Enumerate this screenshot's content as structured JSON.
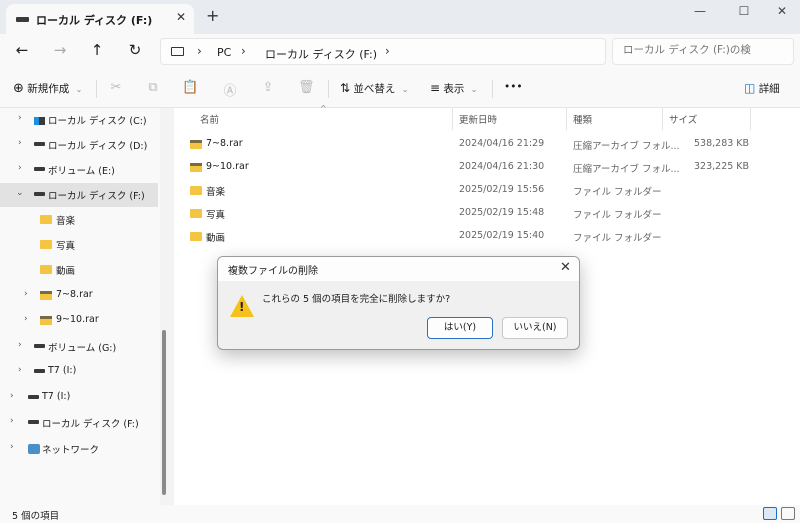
{
  "tab": {
    "title": "ローカル ディスク (F:)",
    "close": "✕",
    "new": "+"
  },
  "window": {
    "minimize": "—",
    "maximize": "☐",
    "close": "✕"
  },
  "nav": {
    "back": "←",
    "forward": "→",
    "up": "↑",
    "refresh": "↻"
  },
  "address": {
    "crumbs": [
      "PC",
      "ローカル ディスク (F:)"
    ],
    "sep": "›"
  },
  "search": {
    "placeholder": "ローカル ディスク (F:)の検"
  },
  "toolbar": {
    "new_label": "新規作成",
    "new_icon": "⊕",
    "sort_label": "並べ替え",
    "sort_icon": "⇅",
    "view_label": "表示",
    "view_icon": "≡",
    "more": "•••",
    "details_label": "詳細",
    "details_icon": "◫",
    "cut_icon": "✂",
    "copy_icon": "⧉",
    "paste_icon": "📋",
    "rename_icon": "Ⓐ",
    "share_icon": "⇪",
    "delete_icon": "🗑",
    "chevron": "⌄"
  },
  "sidebar": {
    "items": [
      {
        "label": "ローカル ディスク (C:)",
        "expand": "›",
        "icon": "windows-drive"
      },
      {
        "label": "ローカル ディスク (D:)",
        "expand": "›",
        "icon": "drive"
      },
      {
        "label": "ボリューム (E:)",
        "expand": "›",
        "icon": "drive"
      },
      {
        "label": "ローカル ディスク (F:)",
        "expand": "⌄",
        "icon": "drive",
        "selected": true
      },
      {
        "label": "音楽",
        "expand": "",
        "icon": "folder"
      },
      {
        "label": "写真",
        "expand": "",
        "icon": "folder"
      },
      {
        "label": "動画",
        "expand": "",
        "icon": "folder"
      },
      {
        "label": "7~8.rar",
        "expand": "›",
        "icon": "archive"
      },
      {
        "label": "9~10.rar",
        "expand": "›",
        "icon": "archive"
      },
      {
        "label": "ボリューム (G:)",
        "expand": "›",
        "icon": "drive"
      },
      {
        "label": "T7 (I:)",
        "expand": "›",
        "icon": "drive"
      },
      {
        "label": "T7 (I:)",
        "expand": "›",
        "icon": "drive"
      },
      {
        "label": "ローカル ディスク (F:)",
        "expand": "›",
        "icon": "drive"
      },
      {
        "label": "ネットワーク",
        "expand": "›",
        "icon": "network"
      }
    ]
  },
  "columns": {
    "name": "名前",
    "modified": "更新日時",
    "type": "種類",
    "size": "サイズ",
    "sort_arrow": "^"
  },
  "files": [
    {
      "name": "7~8.rar",
      "modified": "2024/04/16 21:29",
      "type": "圧縮アーカイブ フォル...",
      "size": "538,283 KB",
      "icon": "archive"
    },
    {
      "name": "9~10.rar",
      "modified": "2024/04/16 21:30",
      "type": "圧縮アーカイブ フォル...",
      "size": "323,225 KB",
      "icon": "archive"
    },
    {
      "name": "音楽",
      "modified": "2025/02/19 15:56",
      "type": "ファイル フォルダー",
      "size": "",
      "icon": "folder"
    },
    {
      "name": "写真",
      "modified": "2025/02/19 15:48",
      "type": "ファイル フォルダー",
      "size": "",
      "icon": "folder"
    },
    {
      "name": "動画",
      "modified": "2025/02/19 15:40",
      "type": "ファイル フォルダー",
      "size": "",
      "icon": "folder"
    }
  ],
  "status": {
    "count": "5 個の項目"
  },
  "dialog": {
    "title": "複数ファイルの削除",
    "close": "✕",
    "message": "これらの 5 個の項目を完全に削除しますか?",
    "warning_mark": "!",
    "yes": "はい(Y)",
    "no": "いいえ(N)"
  },
  "colors": {
    "accent": "#2c6fc0",
    "folder": "#f4c542",
    "warning": "#f6c118"
  }
}
